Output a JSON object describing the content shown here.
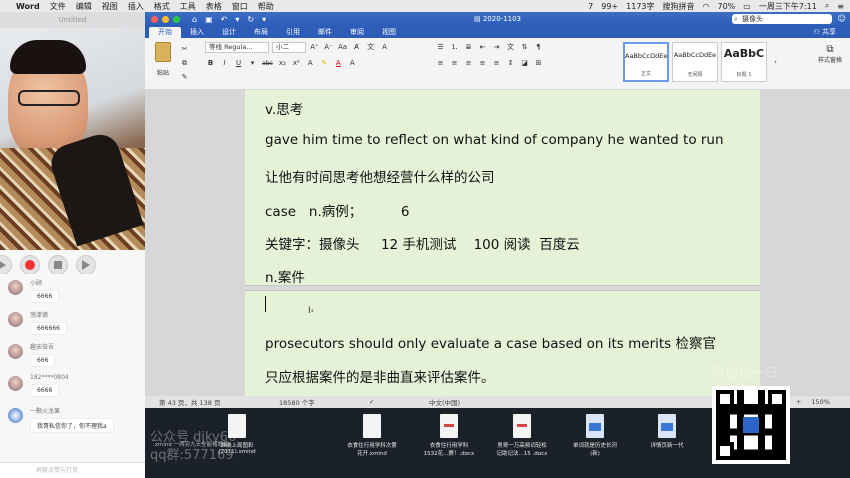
{
  "menubar": {
    "app_name": "Word",
    "items": [
      "文件",
      "编辑",
      "视图",
      "插入",
      "格式",
      "工具",
      "表格",
      "窗口",
      "帮助"
    ],
    "status": {
      "num_seven": "7",
      "battery_badge": "99+",
      "network": "1173字",
      "input_method": "搜狗拼音",
      "wifi_pct": "70%",
      "datetime": "一周三下午7:11"
    }
  },
  "left_panel": {
    "title": "Untitled",
    "chat": [
      {
        "name": "小顾",
        "message": "6666"
      },
      {
        "name": "荡漾德",
        "message": "666666"
      },
      {
        "name": "趣宋倍吾",
        "message": "666"
      },
      {
        "name": "182****0804",
        "message": "6666"
      },
      {
        "name": "一颗火龙果",
        "message": "我哥私信你了，你不理我a"
      }
    ],
    "input_placeholder": "屏蔽点赞与打赏"
  },
  "word": {
    "doc_title": "2020-1103",
    "search_value": "摄像头",
    "tabs": [
      "开始",
      "插入",
      "设计",
      "布局",
      "引用",
      "邮件",
      "审阅",
      "视图"
    ],
    "active_tab": 0,
    "share_label": "共享",
    "ribbon": {
      "paste_label": "粘贴",
      "font_name": "等线 Regula...",
      "font_size": "小二",
      "styles": [
        {
          "sample": "AaBbCcDdEe",
          "name": "正文"
        },
        {
          "sample": "AaBbCcDdEe",
          "name": "无间隔"
        },
        {
          "sample": "AaBbC",
          "name": "标题 1"
        }
      ],
      "styles_pane_label": "样式窗格"
    },
    "document_lines": [
      "v.思考",
      "gave him time to reflect on what kind of company he wanted to run",
      "让他有时间思考他想经营什么样的公司",
      "case   n.病例；         6",
      "关键字：摄像头     12 手机测试    100 阅读  百度云",
      "n.案件",
      "prosecutors should only evaluate a case based on its merits 检察官",
      "只应根据案件的是非曲直来评估案件。"
    ],
    "status_bar": {
      "page": "第 43 页，共 138 页",
      "words": "18580 个字",
      "language": "中文(中国)",
      "zoom": "150%"
    }
  },
  "watermarks": {
    "wechat_scan": "微信扫一扫",
    "public_account": "公众号 djky66",
    "qq_group": "qq群:577169"
  },
  "desktop_files": [
    {
      "name": ".xmind  一两穷九天全能错题练"
    },
    {
      "name": "准确上局图彩\n(2011).xmind"
    },
    {
      "name": "衣食住行用学科次第\n花开.xmind"
    },
    {
      "name": "衣食住行用学科\n1532花...赛！.docx"
    },
    {
      "name": "男哥一万高频词轻松\n记助记法...15 .docx"
    },
    {
      "name": "单词就是历史长河\n(新)"
    },
    {
      "name": "详情页新一代"
    }
  ]
}
